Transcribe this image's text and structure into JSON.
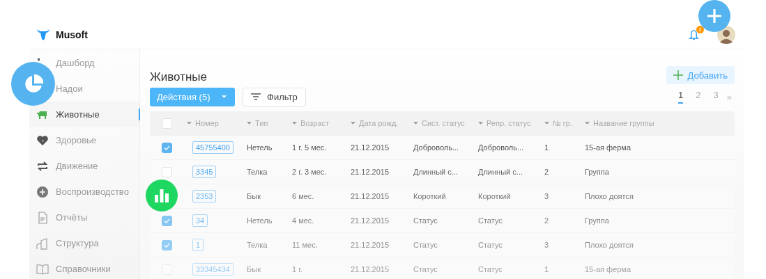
{
  "app": {
    "name": "Musoft",
    "notifications": "2"
  },
  "sidebar": {
    "items": [
      {
        "label": "Дашборд",
        "selected": false
      },
      {
        "label": "Надои",
        "selected": false
      },
      {
        "label": "Животные",
        "selected": true
      },
      {
        "label": "Здоровье",
        "selected": false
      },
      {
        "label": "Движение",
        "selected": false
      },
      {
        "label": "Воспроизводство",
        "selected": false
      },
      {
        "label": "Отчёты",
        "selected": false
      },
      {
        "label": "Структура",
        "selected": false
      },
      {
        "label": "Справочники",
        "selected": false
      }
    ]
  },
  "page": {
    "title": "Животные",
    "add_button": "Добавить",
    "actions_button": "Действия (5)",
    "filter_button": "Фильтр"
  },
  "pagination": {
    "pages": [
      {
        "label": "1",
        "selected": true
      },
      {
        "label": "2",
        "selected": false
      },
      {
        "label": "3",
        "selected": false
      }
    ],
    "next": "»"
  },
  "table": {
    "header_checked": false,
    "columns": [
      "Номер",
      "Тип",
      "Возраст",
      "Дата рожд.",
      "Сист. статус",
      "Репр. статус",
      "№ гр.",
      "Название группы"
    ],
    "rows": [
      {
        "checked": true,
        "cells": [
          "45755400",
          "Нетель",
          "1 г. 5 мес.",
          "21.12.2015",
          "Доброволь...",
          "Доброволь...",
          "1",
          "15-ая ферма"
        ]
      },
      {
        "checked": false,
        "cells": [
          "3345",
          "Телка",
          "2 г. 3 мес.",
          "21.12.2015",
          "Длинный с...",
          "Длинный с...",
          "2",
          "Группа"
        ]
      },
      {
        "cells": [
          "2353",
          "Бык",
          "6 мес.",
          "21.12.2015",
          "Короткий",
          "Короткий",
          "3",
          "Плохо доятся"
        ]
      },
      {
        "checked": true,
        "cells": [
          "34",
          "Нетель",
          "4 мес.",
          "21.12.2015",
          "Статус",
          "Статус",
          "2",
          "Группа"
        ]
      },
      {
        "checked": true,
        "cells": [
          "1",
          "Телка",
          "11 мес.",
          "21.12.2015",
          "Статус",
          "Статус",
          "3",
          "Плохо доятся"
        ]
      },
      {
        "checked": false,
        "cells": [
          "33345434",
          "Бык",
          "1 г.",
          "21.12.2015",
          "Статус",
          "Статус",
          "1",
          "15-ая ферма"
        ]
      }
    ]
  }
}
